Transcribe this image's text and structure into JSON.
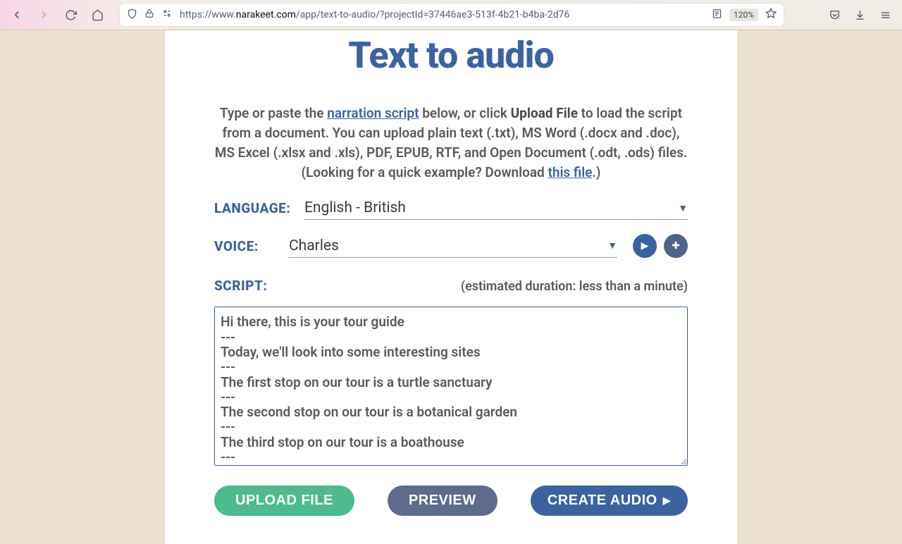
{
  "browser": {
    "url_full": "https://www.narakeet.com/app/text-to-audio/?projectId=37446ae3-513f-4b21-b4ba-2d76",
    "zoom": "120%"
  },
  "page": {
    "title": "Text to audio",
    "intro_prefix": "Type or paste the ",
    "intro_link1": "narration script",
    "intro_mid1": " below, or click ",
    "intro_bold": "Upload File",
    "intro_mid2": " to load the script from a document. You can upload plain text (.txt), MS Word (.docx and .doc), MS Excel (.xlsx and .xls), PDF, EPUB, RTF, and Open Document (.odt, .ods) files.",
    "intro_example_prefix": "(Looking for a quick example? Download ",
    "intro_link2": "this file",
    "intro_example_suffix": ".)"
  },
  "form": {
    "language_label": "LANGUAGE:",
    "language_value": "English - British",
    "voice_label": "VOICE:",
    "voice_value": "Charles",
    "script_label": "SCRIPT:",
    "est_duration": "(estimated duration: less than a minute)",
    "script_text": "Hi there, this is your tour guide\n---\nToday, we'll look into some interesting sites\n---\nThe first stop on our tour is a turtle sanctuary\n---\nThe second stop on our tour is a botanical garden\n---\nThe third stop on our tour is a boathouse\n---"
  },
  "buttons": {
    "upload": "UPLOAD FILE",
    "preview": "PREVIEW",
    "create": "CREATE AUDIO"
  }
}
